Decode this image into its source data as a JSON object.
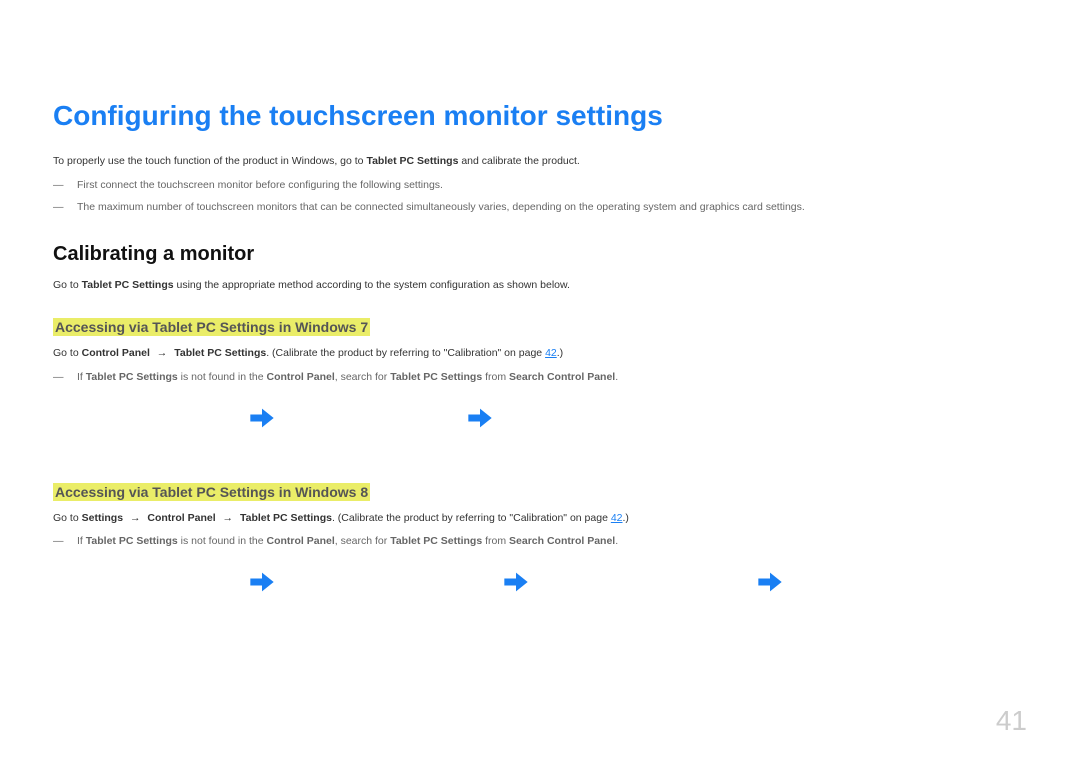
{
  "heading1": "Configuring the touchscreen monitor settings",
  "intro": {
    "p1_before": "To properly use the touch function of the product in Windows, go to ",
    "p1_bold": "Tablet PC Settings",
    "p1_after": " and calibrate the product."
  },
  "notes": {
    "n1": "First connect the touchscreen monitor before configuring the following settings.",
    "n2": "The maximum number of touchscreen monitors that can be connected simultaneously varies, depending on the operating system and graphics card settings."
  },
  "heading2": "Calibrating a monitor",
  "subintro": {
    "before": "Go to ",
    "bold": "Tablet PC Settings",
    "after": " using the appropriate method according to the system configuration as shown below."
  },
  "win7": {
    "heading": "Accessing via Tablet PC Settings in Windows 7",
    "body": {
      "pre": "Go to ",
      "b1": "Control Panel",
      "arrow1": " → ",
      "b2": "Tablet PC Settings",
      "post": ". (Calibrate the product by referring to \"Calibration\" on page ",
      "link": "42",
      "end": ".)"
    },
    "note": {
      "pre": "If ",
      "b1": "Tablet PC Settings",
      "mid1": " is not found in the ",
      "b2": "Control Panel",
      "mid2": ", search for ",
      "b3": "Tablet PC Settings",
      "mid3": " from ",
      "b4": "Search Control Panel",
      "end": "."
    }
  },
  "win8": {
    "heading": "Accessing via Tablet PC Settings in Windows 8",
    "body": {
      "pre": "Go to ",
      "b1": "Settings",
      "arrow1": " → ",
      "b2": "Control Panel",
      "arrow2": " → ",
      "b3": "Tablet PC Settings",
      "post": ". (Calibrate the product by referring to \"Calibration\" on page ",
      "link": "42",
      "end": ".)"
    },
    "note": {
      "pre": "If ",
      "b1": "Tablet PC Settings",
      "mid1": " is not found in the ",
      "b2": "Control Panel",
      "mid2": ", search for ",
      "b3": "Tablet PC Settings",
      "mid3": " from ",
      "b4": "Search Control Panel",
      "end": "."
    }
  },
  "page_number": "41",
  "em_dash": "―"
}
